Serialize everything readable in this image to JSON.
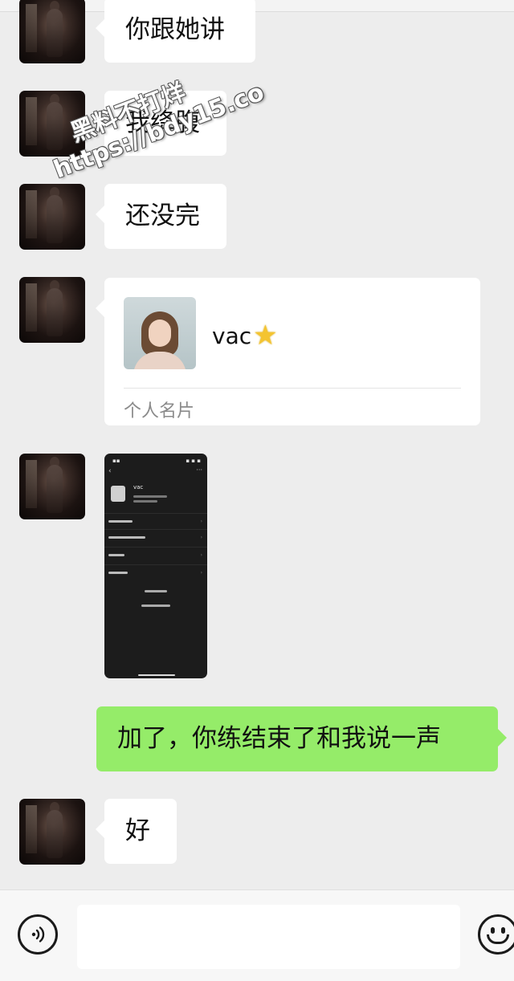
{
  "messages": [
    {
      "side": "left",
      "text": "你跟她讲"
    },
    {
      "side": "left",
      "text": "我绛腹"
    },
    {
      "side": "left",
      "text": "还没完"
    },
    {
      "side": "left",
      "type": "contact_card",
      "name": "vac",
      "label": "个人名片"
    },
    {
      "side": "left",
      "type": "image",
      "image_text": {
        "name": "vac"
      }
    },
    {
      "side": "right",
      "text": "加了，你练结束了和我说一声"
    },
    {
      "side": "left",
      "text": "好"
    }
  ],
  "watermark": {
    "line1": "黑料不打烊",
    "line2": "https://bdy15.co"
  },
  "input_bar": {
    "voice_icon": "voice-icon",
    "emoji_icon": "emoji-icon"
  },
  "colors": {
    "background": "#ededed",
    "received_bubble": "#ffffff",
    "sent_bubble": "#95ec69"
  }
}
